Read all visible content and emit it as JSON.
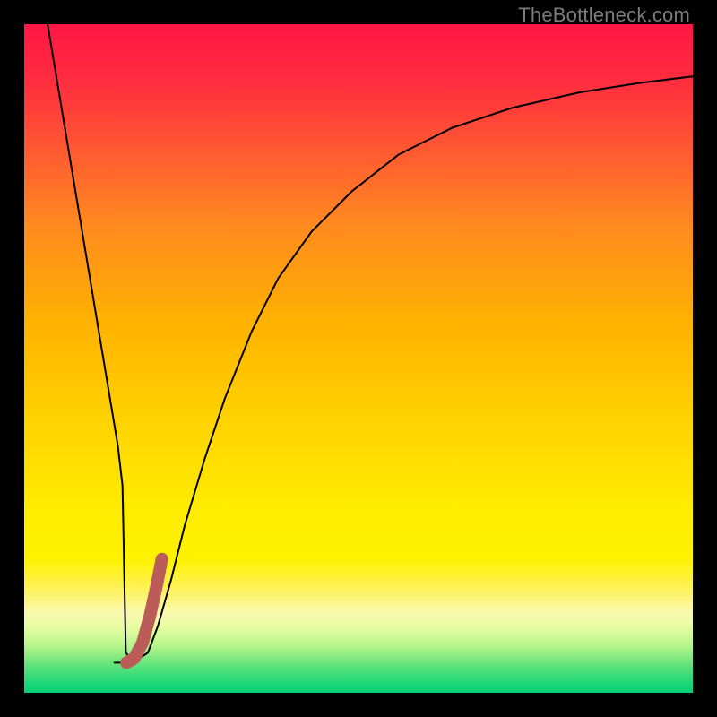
{
  "watermark": "TheBottleneck.com",
  "chart_data": {
    "type": "line",
    "title": "",
    "xlabel": "",
    "ylabel": "",
    "xlim": [
      0,
      100
    ],
    "ylim": [
      0,
      100
    ],
    "background_gradient": {
      "stops": [
        {
          "offset": 0.0,
          "color": "#ff1744"
        },
        {
          "offset": 0.08,
          "color": "#ff2b3f"
        },
        {
          "offset": 0.18,
          "color": "#ff5533"
        },
        {
          "offset": 0.3,
          "color": "#ff8a1f"
        },
        {
          "offset": 0.45,
          "color": "#ffb300"
        },
        {
          "offset": 0.6,
          "color": "#ffd400"
        },
        {
          "offset": 0.72,
          "color": "#ffeb00"
        },
        {
          "offset": 0.8,
          "color": "#fff200"
        },
        {
          "offset": 0.85,
          "color": "#fff266"
        },
        {
          "offset": 0.88,
          "color": "#f9f9b0"
        },
        {
          "offset": 0.9,
          "color": "#eafca2"
        },
        {
          "offset": 0.93,
          "color": "#b5f58a"
        },
        {
          "offset": 0.96,
          "color": "#5de27a"
        },
        {
          "offset": 0.985,
          "color": "#1fd678"
        },
        {
          "offset": 1.0,
          "color": "#00d074"
        }
      ]
    },
    "series": [
      {
        "name": "curve",
        "color": "#000000",
        "stroke_width": 2,
        "x": [
          3.5,
          5,
          7,
          9,
          11,
          13,
          14,
          14.7,
          15.2,
          16,
          17,
          18.5,
          20,
          22,
          24,
          27,
          30,
          34,
          38,
          43,
          49,
          56,
          64,
          73,
          83,
          92,
          100
        ],
        "y": [
          100,
          91,
          79,
          67,
          55,
          43,
          37,
          31,
          6,
          5,
          5,
          6,
          10,
          17,
          25,
          35,
          44,
          54,
          62,
          69,
          75,
          80.5,
          84.5,
          87.5,
          89.8,
          91.2,
          92.2
        ]
      },
      {
        "name": "baseline",
        "color": "#000000",
        "stroke_width": 2,
        "x": [
          13.5,
          16.5
        ],
        "y": [
          4.5,
          4.5
        ]
      },
      {
        "name": "highlight-segment",
        "color": "#bb5c58",
        "stroke_width": 14,
        "x": [
          15.3,
          16.5,
          17.7,
          18.8,
          19.8,
          20.6
        ],
        "y": [
          4.5,
          5.2,
          7.5,
          11.5,
          16.0,
          20.0
        ]
      }
    ]
  }
}
